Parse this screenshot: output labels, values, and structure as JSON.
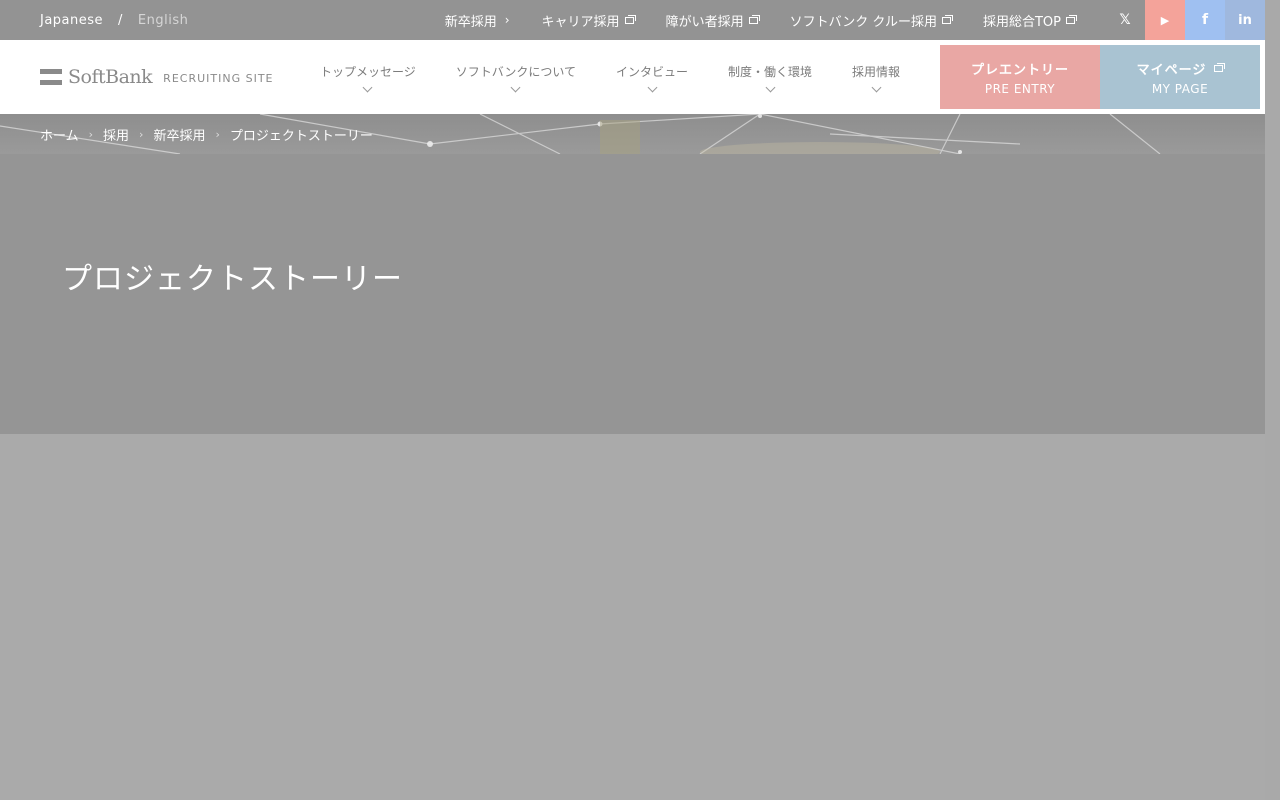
{
  "language": {
    "active": "Japanese",
    "separator": "/",
    "other": "English"
  },
  "utility_links": [
    {
      "label": "新卒採用",
      "type": "chevron"
    },
    {
      "label": "キャリア採用",
      "type": "external"
    },
    {
      "label": "障がい者採用",
      "type": "external"
    },
    {
      "label": "ソフトバンク クルー採用",
      "type": "external"
    },
    {
      "label": "採用総合TOP",
      "type": "external"
    }
  ],
  "social": [
    {
      "icon": "x-icon",
      "glyph": "𝕏",
      "color": "#939393"
    },
    {
      "icon": "youtube-icon",
      "glyph": "▶",
      "color": "#f4a39a"
    },
    {
      "icon": "facebook-icon",
      "glyph": "f",
      "color": "#9fc0f1"
    },
    {
      "icon": "linkedin-icon",
      "glyph": "in",
      "color": "#9fb8de"
    }
  ],
  "logo": {
    "text": "SoftBank",
    "subtitle": "RECRUITING SITE"
  },
  "gnav": [
    {
      "label": "トップメッセージ"
    },
    {
      "label": "ソフトバンクについて"
    },
    {
      "label": "インタビュー"
    },
    {
      "label": "制度・働く環境"
    },
    {
      "label": "採用情報"
    }
  ],
  "cta": {
    "entry": {
      "label": "プレエントリー",
      "sub": "PRE ENTRY",
      "color": "#e9a7a4"
    },
    "mypage": {
      "label": "マイページ",
      "sub": "MY PAGE",
      "color": "#a9c3d2"
    }
  },
  "breadcrumb": [
    "ホーム",
    "採用",
    "新卒採用",
    "プロジェクトストーリー"
  ],
  "breadcrumb_sep": "›",
  "hero": {
    "title": "プロジェクトストーリー"
  }
}
